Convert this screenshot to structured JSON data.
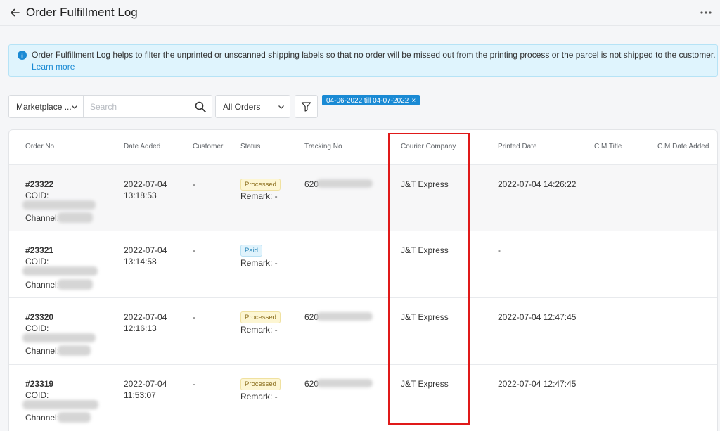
{
  "header": {
    "title": "Order Fulfillment Log",
    "back_icon": "arrow-left-icon",
    "more_icon": "more-horizontal-icon"
  },
  "banner": {
    "icon": "info-icon",
    "text": "Order Fulfillment Log helps to filter the unprinted or unscanned shipping labels so that no order will be missed out from the printing process or the parcel is not shipped to the customer.",
    "link": "Learn more"
  },
  "filters": {
    "marketplace_label": "Marketplace ...",
    "search_placeholder": "Search",
    "search_icon": "search-icon",
    "orders_label": "All Orders",
    "filter_icon": "filter-icon",
    "date_chip": "04-06-2022 till 04-07-2022",
    "chip_close": "×"
  },
  "table": {
    "columns": [
      "Order No",
      "Date Added",
      "Customer",
      "Status",
      "Tracking No",
      "Courier Company",
      "Printed Date",
      "C.M Title",
      "C.M Date Added"
    ],
    "coid_label": "COID:",
    "channel_label": "Channel:",
    "remark_label": "Remark: -",
    "rows": [
      {
        "order_no": "#23322",
        "date": "2022-07-04",
        "time": "13:18:53",
        "customer": "-",
        "status": "Processed",
        "tracking": "620",
        "courier": "J&T Express",
        "printed": "2022-07-04 14:26:22"
      },
      {
        "order_no": "#23321",
        "date": "2022-07-04",
        "time": "13:14:58",
        "customer": "-",
        "status": "Paid",
        "tracking": "",
        "courier": "J&T Express",
        "printed": "-"
      },
      {
        "order_no": "#23320",
        "date": "2022-07-04",
        "time": "12:16:13",
        "customer": "-",
        "status": "Processed",
        "tracking": "620",
        "courier": "J&T Express",
        "printed": "2022-07-04 12:47:45"
      },
      {
        "order_no": "#23319",
        "date": "2022-07-04",
        "time": "11:53:07",
        "customer": "-",
        "status": "Processed",
        "tracking": "620",
        "courier": "J&T Express",
        "printed": "2022-07-04 12:47:45"
      }
    ]
  },
  "colors": {
    "accent": "#1a8ad4",
    "highlight": "#e01919",
    "processed_bg": "#fdf6d3",
    "paid_bg": "#e0f3fc"
  }
}
